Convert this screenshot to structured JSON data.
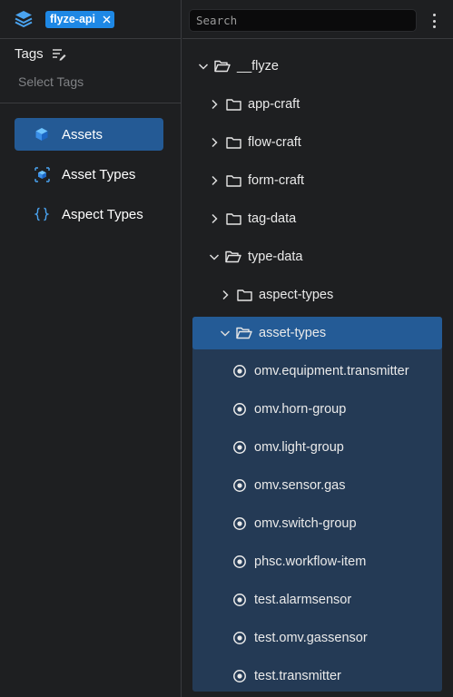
{
  "app": {
    "logo_icon": "stack-layers-icon",
    "project_chip": "flyze-api",
    "chip_close_icon": "close-icon",
    "accent": "#1e88e5"
  },
  "tags": {
    "title": "Tags",
    "edit_icon": "edit-list-icon",
    "placeholder": "Select Tags"
  },
  "nav": [
    {
      "label": "Assets",
      "icon": "cube-icon",
      "active": true
    },
    {
      "label": "Asset Types",
      "icon": "asset-type-icon",
      "active": false
    },
    {
      "label": "Aspect Types",
      "icon": "braces-icon",
      "active": false
    }
  ],
  "search": {
    "placeholder": "Search",
    "value": "",
    "menu_icon": "kebab-menu-icon"
  },
  "tree": {
    "root": {
      "label": "__flyze",
      "expanded": true
    },
    "children": [
      {
        "label": "app-craft",
        "expanded": false
      },
      {
        "label": "flow-craft",
        "expanded": false
      },
      {
        "label": "form-craft",
        "expanded": false
      },
      {
        "label": "tag-data",
        "expanded": false
      },
      {
        "label": "type-data",
        "expanded": true
      }
    ],
    "type_data_children": [
      {
        "label": "aspect-types",
        "expanded": false
      },
      {
        "label": "asset-types",
        "expanded": true,
        "selected": true
      }
    ],
    "asset_types_items": [
      "omv.equipment.transmitter",
      "omv.horn-group",
      "omv.light-group",
      "omv.sensor.gas",
      "omv.switch-group",
      "phsc.workflow-item",
      "test.alarmsensor",
      "test.omv.gassensor",
      "test.transmitter"
    ]
  }
}
